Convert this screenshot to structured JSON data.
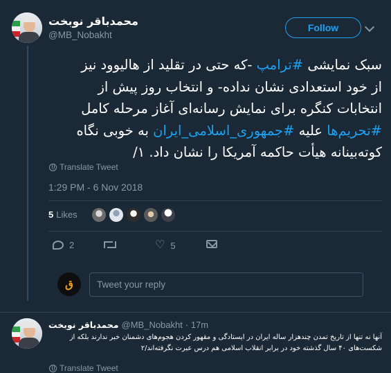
{
  "tweet": {
    "author_name": "محمدباقر نوبخت",
    "author_handle": "@MB_Nobakht",
    "follow_label": "Follow",
    "text_lines": [
      {
        "parts": [
          {
            "t": "سبک نمایشی ",
            "tag": false
          },
          {
            "t": "#ترامپ",
            "tag": true
          },
          {
            "t": " -که حتی در تقلید از هالیوود نیز",
            "tag": false
          }
        ]
      },
      {
        "parts": [
          {
            "t": "از خود استعدادی نشان نداده- و انتخاب روز پیش از",
            "tag": false
          }
        ]
      },
      {
        "parts": [
          {
            "t": "انتخابات کنگره برای نمایش رسانه‌ای آغاز مرحله کامل",
            "tag": false
          }
        ]
      },
      {
        "parts": [
          {
            "t": "#تحریم‌ها",
            "tag": true
          },
          {
            "t": " علیه ",
            "tag": false
          },
          {
            "t": "#جمهوری_اسلامی_ایران",
            "tag": true
          },
          {
            "t": " به خوبی نگاه",
            "tag": false
          }
        ]
      },
      {
        "parts": [
          {
            "t": "کوته‌بینانه هیأت حاکمه آمریکا را نشان داد. ۱/",
            "tag": false
          }
        ]
      }
    ],
    "translate_label": "Translate Tweet",
    "timestamp": "1:29 PM - 6 Nov 2018",
    "likes_count": "5",
    "likes_label": "Likes",
    "reply_count": "2",
    "like_action_count": "5"
  },
  "reply_composer": {
    "placeholder": "Tweet your reply"
  },
  "reply": {
    "author_name": "محمدباقر نوبخت",
    "author_handle": "@MB_Nobakht",
    "age": "· 17m",
    "text": "آنها نه تنها از تاریخ تمدن چندهزار ساله ایران در ایستادگی و مقهور کردن هجوم‌های دشمنان خبر ندارند بلکه از شکست‌های ۴۰ سال گذشته خود در برابر انقلاب اسلامی هم درس عبرت نگرفته‌اند/۲",
    "translate_label": "Translate Tweet"
  },
  "colors": {
    "background": "#1b2836",
    "accent": "#1da1f2",
    "muted": "#8899a6"
  }
}
